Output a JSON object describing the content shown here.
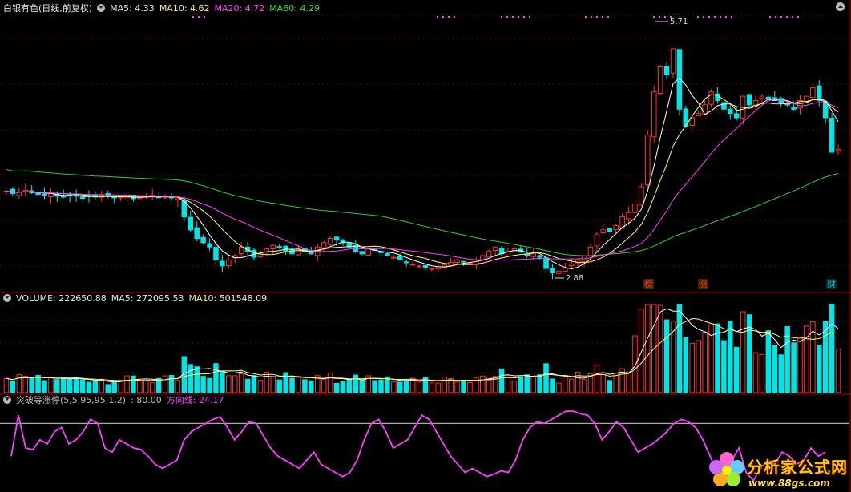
{
  "main_panel": {
    "title": "白银有色(日线,前复权)",
    "ma5_label": "MA5: 4.33",
    "ma10_label": "MA10: 4.62",
    "ma20_label": "MA20: 4.72",
    "ma60_label": "MA60: 4.29",
    "high_label": "5.71",
    "low_label": "2.88",
    "events": [
      "榜",
      "涨",
      "财"
    ]
  },
  "volume_panel": {
    "title": "VOLUME: 222650.88",
    "ma5_label": "MA5: 272095.53",
    "ma10_label": "MA10: 501548.09"
  },
  "indicator_panel": {
    "title": "突破等涨停(5,5,95,95,1,2)",
    "value_label": ": 80.00",
    "direction_label": "方向线: 24.17"
  },
  "watermark": {
    "name": "分析家公式网",
    "url": "www.88gs.com"
  },
  "colors": {
    "up": "#ff3232",
    "down": "#00e6e6",
    "ma5": "#ffffff",
    "ma10": "#ffff66",
    "ma20": "#ff40ff",
    "ma60": "#33cc33",
    "indicator": "#ff40ff",
    "grid": "#6a0000"
  },
  "chart_data": {
    "type": "candlestick",
    "price_high": 5.71,
    "price_low": 2.88,
    "indicator_reference_line": 80,
    "indicator_direction_value": 24.17,
    "volume_last": 222650.88,
    "volume_ma5_last": 272095.53,
    "volume_ma10_last": 501548.09,
    "ma_last": {
      "MA5": 4.33,
      "MA10": 4.62,
      "MA20": 4.72,
      "MA60": 4.29
    },
    "closes": [
      3.85,
      3.82,
      3.84,
      3.86,
      3.83,
      3.81,
      3.8,
      3.82,
      3.79,
      3.78,
      3.8,
      3.79,
      3.77,
      3.79,
      3.78,
      3.8,
      3.79,
      3.77,
      3.78,
      3.79,
      3.76,
      3.78,
      3.79,
      3.8,
      3.78,
      3.79,
      3.77,
      3.76,
      3.55,
      3.4,
      3.3,
      3.25,
      3.2,
      3.05,
      2.98,
      3.05,
      3.1,
      3.2,
      3.15,
      3.08,
      3.12,
      3.18,
      3.22,
      3.2,
      3.15,
      3.12,
      3.18,
      3.15,
      3.12,
      3.2,
      3.25,
      3.3,
      3.28,
      3.25,
      3.2,
      3.15,
      3.12,
      3.18,
      3.16,
      3.14,
      3.1,
      3.08,
      3.05,
      3.02,
      3.0,
      2.98,
      2.96,
      2.95,
      2.97,
      2.99,
      3.02,
      3.05,
      3.03,
      3.01,
      3.05,
      3.1,
      3.15,
      3.2,
      3.12,
      3.15,
      3.18,
      3.14,
      3.1,
      3.12,
      3.08,
      2.95,
      2.9,
      2.92,
      2.96,
      3.0,
      3.05,
      3.1,
      3.2,
      3.35,
      3.4,
      3.38,
      3.45,
      3.55,
      3.6,
      3.7,
      3.9,
      4.5,
      5.0,
      5.3,
      5.2,
      5.5,
      4.8,
      4.6,
      4.7,
      4.75,
      4.85,
      5.0,
      4.9,
      4.8,
      4.75,
      4.7,
      4.95,
      4.85,
      4.9,
      4.95,
      4.92,
      4.9,
      4.88,
      4.85,
      4.8,
      4.9,
      4.95,
      5.05,
      4.9,
      4.7,
      4.3,
      4.33
    ],
    "indicator": [
      40,
      90,
      50,
      48,
      60,
      55,
      70,
      75,
      55,
      60,
      70,
      85,
      80,
      50,
      45,
      60,
      55,
      50,
      48,
      40,
      30,
      25,
      30,
      35,
      60,
      70,
      75,
      80,
      85,
      88,
      75,
      60,
      70,
      82,
      80,
      65,
      50,
      40,
      35,
      30,
      25,
      35,
      45,
      30,
      25,
      20,
      15,
      20,
      35,
      60,
      80,
      85,
      70,
      50,
      55,
      60,
      75,
      90,
      85,
      70,
      55,
      40,
      30,
      20,
      25,
      20,
      15,
      18,
      22,
      20,
      35,
      60,
      75,
      82,
      80,
      85,
      90,
      95,
      95,
      92,
      90,
      80,
      60,
      70,
      82,
      75,
      60,
      45,
      50,
      55,
      62,
      70,
      80,
      85,
      82,
      75,
      60,
      40,
      20,
      25,
      35,
      50,
      20,
      10,
      25,
      35,
      30,
      45,
      40,
      30,
      35,
      50,
      40,
      45
    ]
  }
}
